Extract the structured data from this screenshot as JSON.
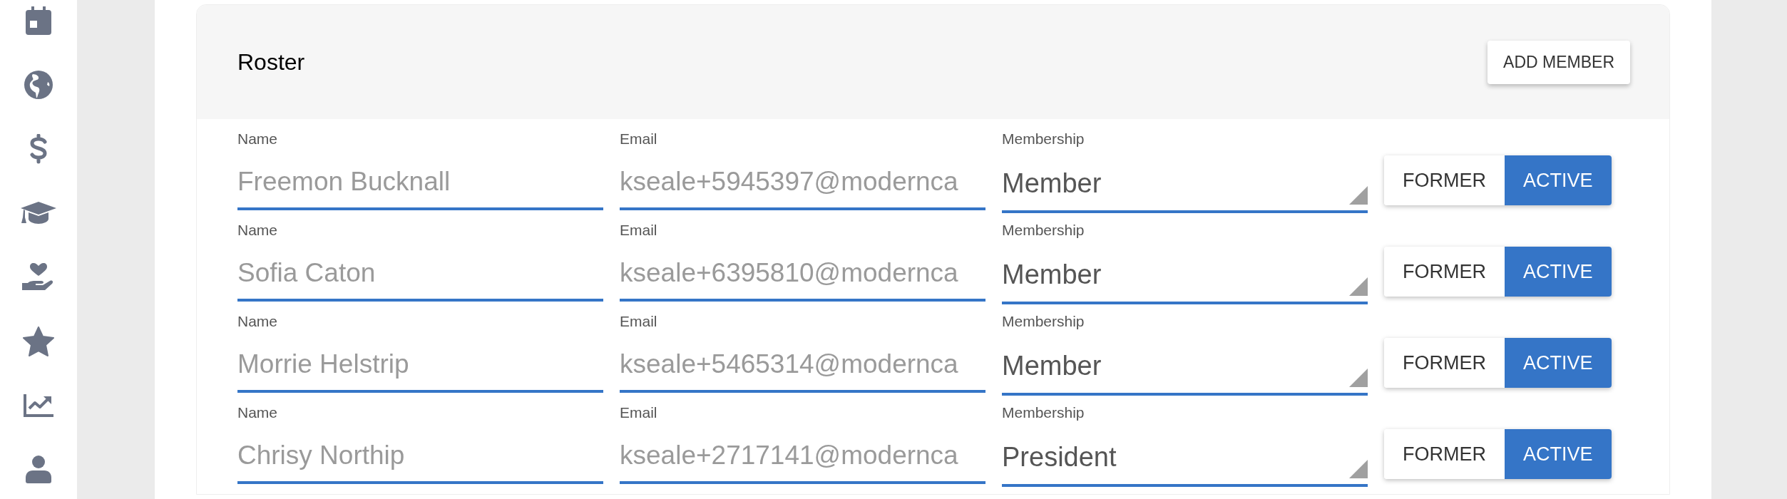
{
  "sidebar": {
    "items": [
      {
        "kind": "calendar"
      },
      {
        "kind": "globe"
      },
      {
        "kind": "dollar"
      },
      {
        "kind": "cap"
      },
      {
        "kind": "hand"
      },
      {
        "kind": "star"
      },
      {
        "kind": "chart"
      },
      {
        "kind": "user"
      }
    ]
  },
  "roster": {
    "title": "Roster",
    "add_button": "ADD MEMBER",
    "members": [
      {
        "name_label": "Name",
        "name": "Freemon Bucknall",
        "email_label": "Email",
        "email": "kseale+5945397@modernca",
        "membership_label": "Membership",
        "membership": "Member",
        "status": [
          {
            "label": "FORMER",
            "selected": false
          },
          {
            "label": "ACTIVE",
            "selected": true
          }
        ]
      },
      {
        "name_label": "Name",
        "name": "Sofia Caton",
        "email_label": "Email",
        "email": "kseale+6395810@modernca",
        "membership_label": "Membership",
        "membership": "Member",
        "status": [
          {
            "label": "FORMER",
            "selected": false
          },
          {
            "label": "ACTIVE",
            "selected": true
          }
        ]
      },
      {
        "name_label": "Name",
        "name": "Morrie Helstrip",
        "email_label": "Email",
        "email": "kseale+5465314@modernca",
        "membership_label": "Membership",
        "membership": "Member",
        "status": [
          {
            "label": "FORMER",
            "selected": false
          },
          {
            "label": "ACTIVE",
            "selected": true
          }
        ]
      },
      {
        "name_label": "Name",
        "name": "Chrisy Northip",
        "email_label": "Email",
        "email": "kseale+2717141@modernca",
        "membership_label": "Membership",
        "membership": "President",
        "status": [
          {
            "label": "FORMER",
            "selected": false
          },
          {
            "label": "ACTIVE",
            "selected": true
          }
        ]
      }
    ]
  }
}
